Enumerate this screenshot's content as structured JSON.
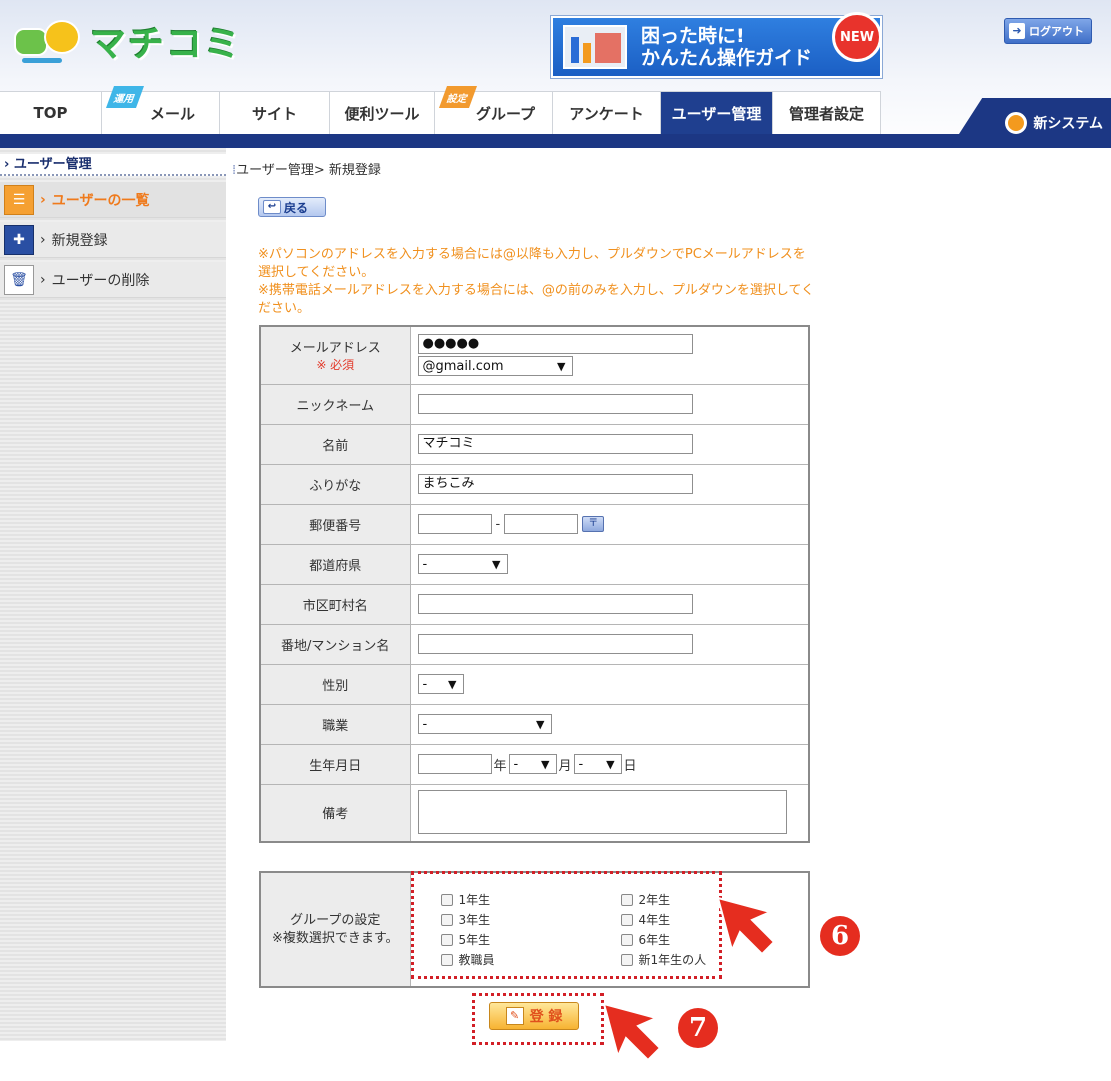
{
  "header": {
    "logo_text": "マチコミ",
    "guide_line1": "困った時に!",
    "guide_line2": "かんたん操作ガイド",
    "new_badge": "NEW",
    "logout_label": "ログアウト",
    "new_system_label": "新システム"
  },
  "tabs": [
    {
      "label": "TOP",
      "ribbon": ""
    },
    {
      "label": "メール",
      "ribbon": "運用"
    },
    {
      "label": "サイト",
      "ribbon": ""
    },
    {
      "label": "便利ツール",
      "ribbon": ""
    },
    {
      "label": "グループ",
      "ribbon": "設定"
    },
    {
      "label": "アンケート",
      "ribbon": ""
    },
    {
      "label": "ユーザー管理",
      "ribbon": ""
    },
    {
      "label": "管理者設定",
      "ribbon": ""
    }
  ],
  "sidebar": {
    "heading": "ユーザー管理",
    "items": [
      {
        "label": "ユーザーの一覧"
      },
      {
        "label": "新規登録"
      },
      {
        "label": "ユーザーの削除"
      }
    ]
  },
  "breadcrumb": "ユーザー管理> 新規登録",
  "back_label": "戻る",
  "notice": [
    "※パソコンのアドレスを入力する場合には@以降も入力し、プルダウンでPCメールアドレスを選択してください。",
    "※携帯電話メールアドレスを入力する場合には、@の前のみを入力し、プルダウンを選択してください。"
  ],
  "form": {
    "email_label": "メールアドレス",
    "required_label": "※ 必須",
    "email_value": "●●●●●",
    "email_domain": "@gmail.com",
    "nickname_label": "ニックネーム",
    "name_label": "名前",
    "name_value": "マチコミ",
    "furigana_label": "ふりがな",
    "furigana_value": "まちこみ",
    "zip_label": "郵便番号",
    "zip_sep": "-",
    "pref_label": "都道府県",
    "pref_value": "-",
    "city_label": "市区町村名",
    "address_label": "番地/マンション名",
    "gender_label": "性別",
    "gender_value": "-",
    "job_label": "職業",
    "job_value": "-",
    "birth_label": "生年月日",
    "birth_year_unit": "年",
    "birth_month_value": "-",
    "birth_month_unit": "月",
    "birth_day_value": "-",
    "birth_day_unit": "日",
    "note_label": "備考"
  },
  "group": {
    "label_line1": "グループの設定",
    "label_line2": "※複数選択できます。",
    "options": [
      "1年生",
      "2年生",
      "3年生",
      "4年生",
      "5年生",
      "6年生",
      "教職員",
      "新1年生の人"
    ]
  },
  "register_label": "登 録",
  "annotations": {
    "six": "6",
    "seven": "7"
  },
  "colors": {
    "nav_blue": "#1c3784",
    "orange_text": "#f0901e",
    "annotation_red": "#d21f26"
  }
}
